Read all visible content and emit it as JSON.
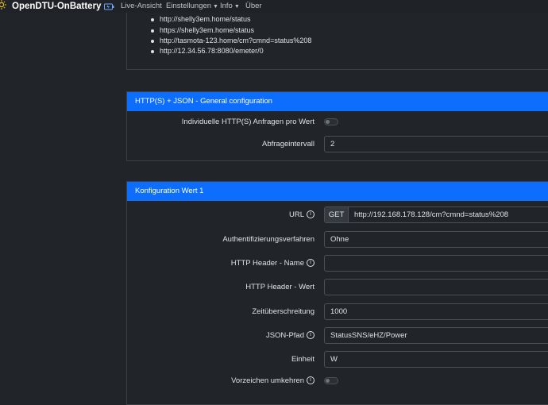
{
  "navbar": {
    "brand": "OpenDTU-OnBattery",
    "items": [
      {
        "label": "Live-Ansicht"
      },
      {
        "label": "Einstellungen"
      },
      {
        "label": "Info"
      },
      {
        "label": "Über"
      }
    ]
  },
  "example_urls": [
    "http://shelly3em.home/status",
    "https://shelly3em.home/status",
    "http://tasmota-123.home/cm?cmnd=status%208",
    "http://12.34.56.78:8080/emeter/0"
  ],
  "general": {
    "header": "HTTP(S) + JSON - General configuration",
    "individual_label": "Individuelle HTTP(S) Anfragen pro Wert",
    "individual_on": false,
    "interval_label": "Abfrageintervall",
    "interval_value": "2"
  },
  "value1": {
    "header": "Konfiguration Wert 1",
    "url_label": "URL",
    "method": "GET",
    "url_value": "http://192.168.178.128/cm?cmnd=status%208",
    "auth_label": "Authentifizierungsverfahren",
    "auth_value": "Ohne",
    "header_name_label": "HTTP Header - Name",
    "header_name_value": "",
    "header_value_label": "HTTP Header - Wert",
    "header_value_value": "",
    "timeout_label": "Zeitüberschreitung",
    "timeout_value": "1000",
    "json_path_label": "JSON-Pfad",
    "json_path_value": "StatusSNS/eHZ/Power",
    "unit_label": "Einheit",
    "unit_value": "W",
    "invert_label": "Vorzeichen umkehren",
    "invert_on": false
  },
  "colors": {
    "accent": "#0d6efd",
    "background": "#212529"
  }
}
